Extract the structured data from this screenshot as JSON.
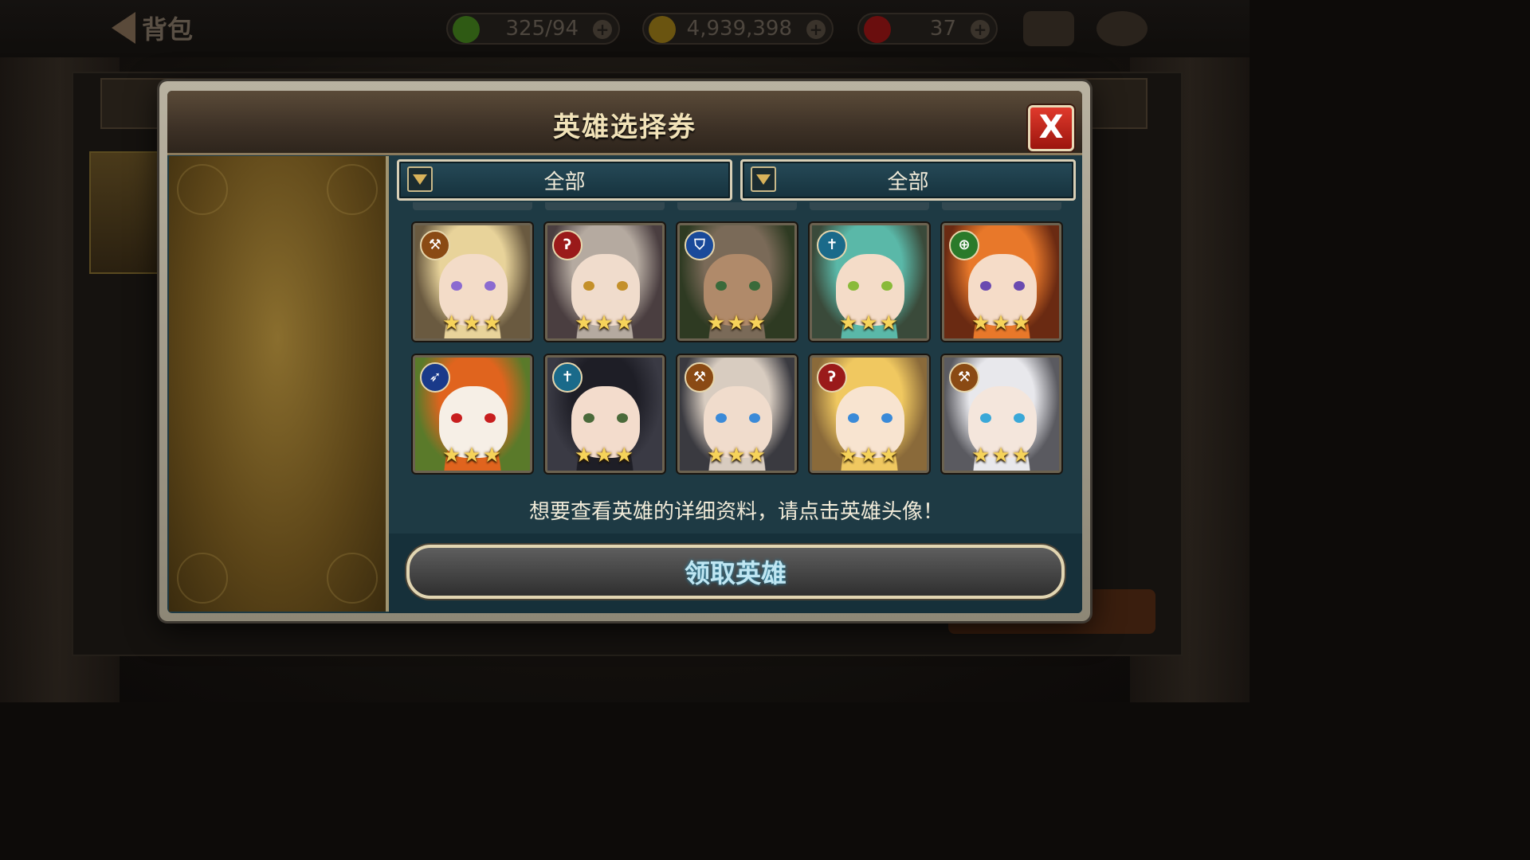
{
  "background": {
    "back_label": "背包",
    "resources": [
      {
        "name": "stamina",
        "value": "325/94",
        "icon": "lightning-icon",
        "color": "#3a6a1a"
      },
      {
        "name": "gold",
        "value": "4,939,398",
        "icon": "coin-icon",
        "color": "#8a6a10"
      },
      {
        "name": "gem",
        "value": "37",
        "icon": "gem-icon",
        "color": "#8a1010"
      }
    ]
  },
  "modal": {
    "title": "英雄选择券",
    "close_label": "X",
    "filters": [
      {
        "label": "全部"
      },
      {
        "label": "全部"
      }
    ],
    "heroes": [
      {
        "class_icon": "axe-icon",
        "class_color": "#8a4a14",
        "hair": "#e8d39a",
        "skin": "#f3dcc8",
        "eye": "#8b6bd0",
        "bg": "#6a5a40",
        "stars": "★★★"
      },
      {
        "class_icon": "staff-icon",
        "class_color": "#9a1a1a",
        "hair": "#b5aaa0",
        "skin": "#f0dccc",
        "eye": "#c4902a",
        "bg": "#4a3e40",
        "stars": "★★★"
      },
      {
        "class_icon": "shield-icon",
        "class_color": "#1a4a9a",
        "hair": "#7a6a58",
        "skin": "#b08a6a",
        "eye": "#3a6a3a",
        "bg": "#2e3a22",
        "stars": "★★★"
      },
      {
        "class_icon": "cross-icon",
        "class_color": "#1a6a8a",
        "hair": "#5ab8a8",
        "skin": "#f4dcc8",
        "eye": "#8aba3a",
        "bg": "#3a4a3a",
        "stars": "★★★"
      },
      {
        "class_icon": "bow-icon",
        "class_color": "#2a7a2a",
        "hair": "#e8782a",
        "skin": "#f5dcc8",
        "eye": "#6a4ab0",
        "bg": "#6a2a12",
        "stars": "★★★"
      },
      {
        "class_icon": "gun-icon",
        "class_color": "#1a3a8a",
        "hair": "#e0641e",
        "skin": "#f6efe6",
        "eye": "#c81e1e",
        "bg": "#5a7a2a",
        "stars": "★★★"
      },
      {
        "class_icon": "cross-icon",
        "class_color": "#1a6a8a",
        "hair": "#1e1e26",
        "skin": "#f3dccc",
        "eye": "#4a6a3a",
        "bg": "#3a3a44",
        "stars": "★★★"
      },
      {
        "class_icon": "axe-icon",
        "class_color": "#8a4a14",
        "hair": "#d8ccc0",
        "skin": "#f0dccc",
        "eye": "#3a8ad8",
        "bg": "#3a3a40",
        "stars": "★★★"
      },
      {
        "class_icon": "staff-icon",
        "class_color": "#9a1a1a",
        "hair": "#f0c860",
        "skin": "#f8e4d0",
        "eye": "#3a8ad8",
        "bg": "#8a6a3a",
        "stars": "★★★"
      },
      {
        "class_icon": "axe-icon",
        "class_color": "#8a4a14",
        "hair": "#e8e8ec",
        "skin": "#f4e6dc",
        "eye": "#3aa8d8",
        "bg": "#5a5a60",
        "stars": "★★★"
      }
    ],
    "hint": "想要查看英雄的详细资料，请点击英雄头像！",
    "claim_label": "领取英雄"
  }
}
